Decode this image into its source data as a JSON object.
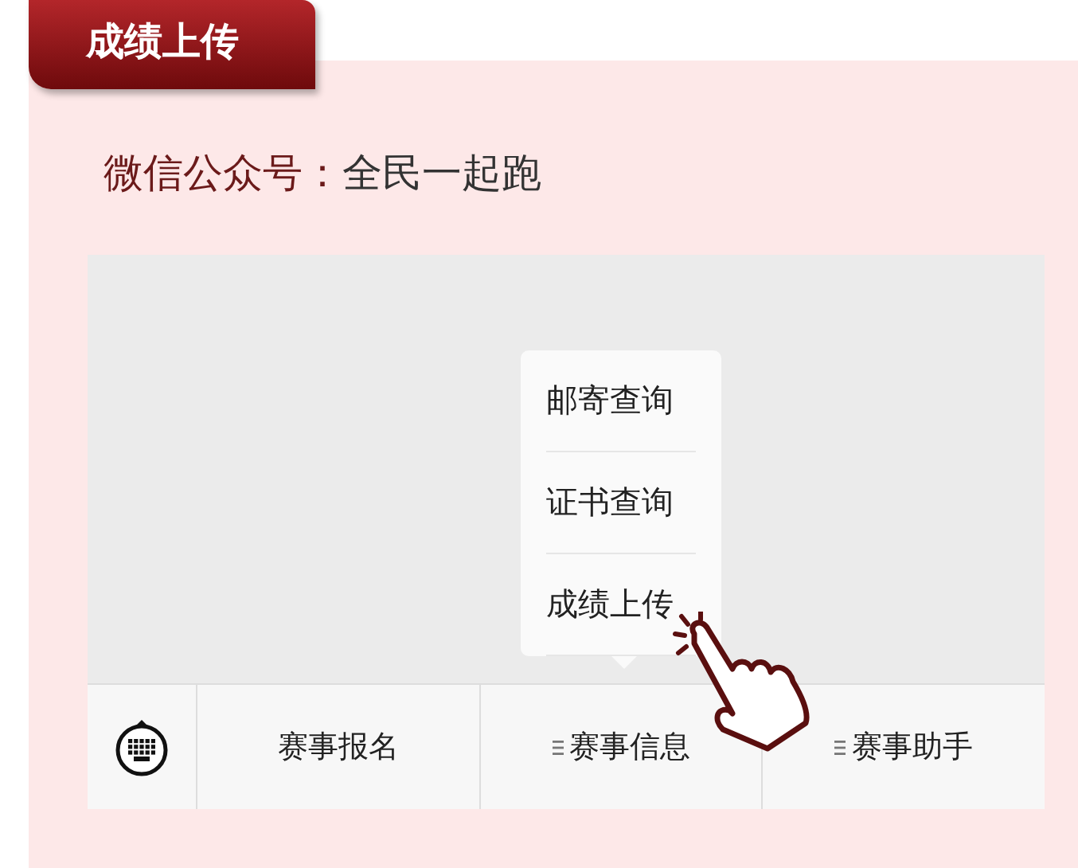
{
  "header_tab": {
    "title": "成绩上传"
  },
  "account": {
    "label": "微信公众号：",
    "value": "全民一起跑"
  },
  "popup_menu": {
    "items": [
      {
        "label": "邮寄查询"
      },
      {
        "label": "证书查询"
      },
      {
        "label": "成绩上传"
      }
    ]
  },
  "bottom_menu": {
    "items": [
      {
        "label": "赛事报名",
        "has_submenu": false
      },
      {
        "label": "赛事信息",
        "has_submenu": true
      },
      {
        "label": "赛事助手",
        "has_submenu": true
      }
    ]
  }
}
